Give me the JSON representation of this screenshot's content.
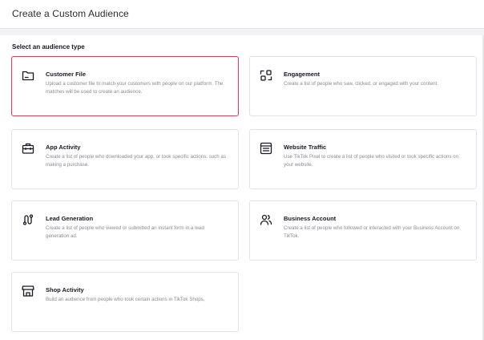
{
  "header": {
    "title": "Create a Custom Audience"
  },
  "section": {
    "label": "Select an audience type"
  },
  "cards": {
    "customer_file": {
      "title": "Customer File",
      "desc": "Upload a customer file to match your customers with people on our platform. The matches will be used to create an audience.",
      "icon": "folder-icon",
      "selected": true
    },
    "engagement": {
      "title": "Engagement",
      "desc": "Create a list of people who saw, clicked, or engaged with your content.",
      "icon": "engagement-icon"
    },
    "app_activity": {
      "title": "App Activity",
      "desc": "Create a list of people who downloaded your app, or took specific actions, such as making a purchase.",
      "icon": "briefcase-icon"
    },
    "website_traffic": {
      "title": "Website Traffic",
      "desc": "Use TikTok Pixel to create a list of people who visited or took specific actions on your website.",
      "icon": "browser-icon"
    },
    "lead_generation": {
      "title": "Lead Generation",
      "desc": "Create a list of people who viewed or submitted an instant form in a lead generation ad.",
      "icon": "path-icon"
    },
    "business_account": {
      "title": "Business Account",
      "desc": "Create a list of people who followed or interacted with your Business Account on TikTok.",
      "icon": "users-icon"
    },
    "shop_activity": {
      "title": "Shop Activity",
      "desc": "Build an audience from people who took certain actions in TikTok Shops.",
      "icon": "shop-icon"
    }
  },
  "colors": {
    "selected_border": "#fe2c55",
    "card_border": "#e3e3e6",
    "desc_text": "#8a8b91"
  }
}
